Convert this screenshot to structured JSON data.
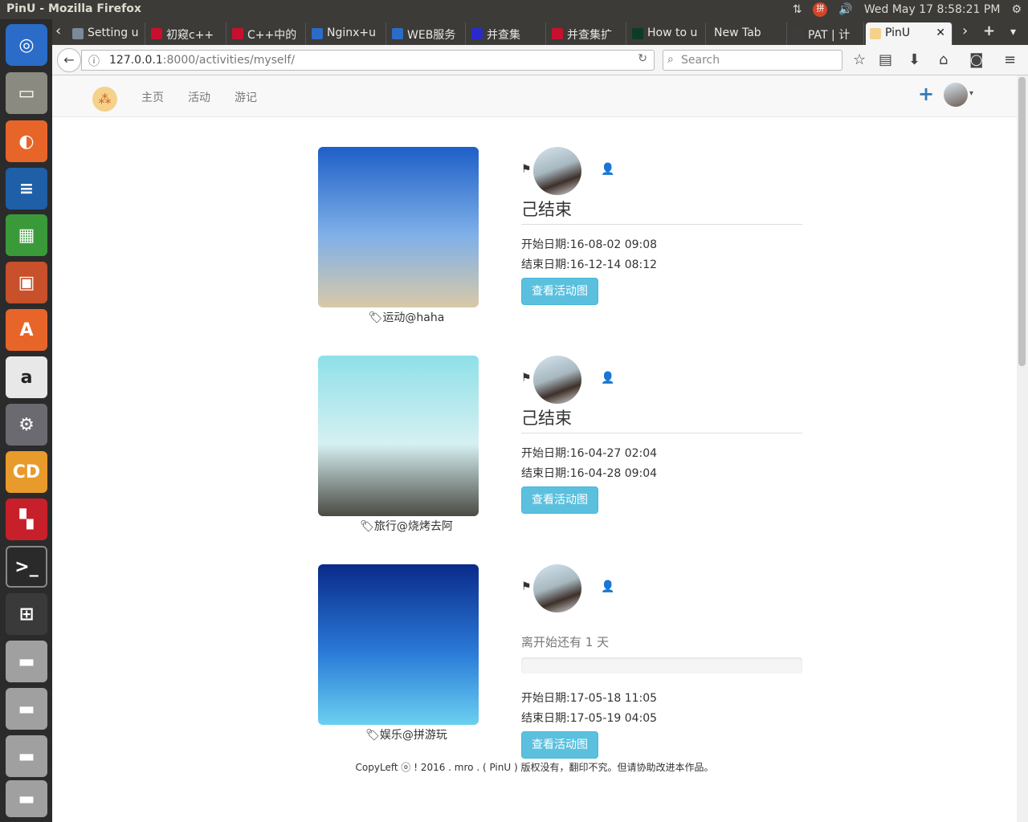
{
  "window": {
    "title": "PinU - Mozilla Firefox"
  },
  "system_tray": {
    "keyboard_indicator": "拼",
    "datetime": "Wed May 17  8:58:21 PM"
  },
  "tabs": [
    {
      "label": "Setting u",
      "icon": "document-icon",
      "color": "#7a8a9a"
    },
    {
      "label": "初窥c++",
      "icon": "csdn-icon",
      "color": "#c8102e"
    },
    {
      "label": "C++中的",
      "icon": "csdn-icon",
      "color": "#c8102e"
    },
    {
      "label": "Nginx+u",
      "icon": "browser-icon",
      "color": "#2a6cc8"
    },
    {
      "label": "WEB服务",
      "icon": "browser-icon",
      "color": "#2a6cc8"
    },
    {
      "label": "并查集",
      "icon": "site-icon",
      "color": "#2a2acc"
    },
    {
      "label": "并查集扩",
      "icon": "csdn-icon",
      "color": "#c8102e"
    },
    {
      "label": "How to u",
      "icon": "django-icon",
      "color": "#0c3c26"
    },
    {
      "label": "New Tab",
      "icon": "",
      "color": ""
    },
    {
      "label": "PAT | 计",
      "icon": "pat-icon",
      "color": "#3c3c3c"
    },
    {
      "label": "PinU",
      "icon": "pinu-icon",
      "color": "#f4d28a"
    }
  ],
  "navbar": {
    "url_host": "127.0.0.1",
    "url_rest": ":8000/activities/myself/",
    "search_placeholder": "Search"
  },
  "site": {
    "logo_glyph": "⁂",
    "nav": [
      "主页",
      "活动",
      "游记"
    ],
    "add_glyph": "+"
  },
  "activities": [
    {
      "caption": "运动@haha",
      "status": "己结束",
      "start": "开始日期:16-08-02 09:08",
      "end": "结束日期:16-12-14 08:12",
      "button": "查看活动图",
      "thumb_colors": [
        "#1e5fc8",
        "#7fb0e8",
        "#d8c9a8"
      ]
    },
    {
      "caption": "旅行@烧烤去阿",
      "status": "己结束",
      "start": "开始日期:16-04-27 02:04",
      "end": "结束日期:16-04-28 09:04",
      "button": "查看活动图",
      "thumb_colors": [
        "#8ee0e8",
        "#d6f0f2",
        "#4a4a42"
      ]
    },
    {
      "caption": "娱乐@拼游玩",
      "status": "离开始还有 1 天",
      "progress": 0,
      "start": "开始日期:17-05-18 11:05",
      "end": "结束日期:17-05-19 04:05",
      "button": "查看活动图",
      "thumb_colors": [
        "#0a2a8a",
        "#2a7ad8",
        "#6ad0f0"
      ]
    }
  ],
  "footer": "CopyLeft ⓞ ! 2016 . mro . ( PinU ) 版权没有，翻印不究。但请协助改进本作品。"
}
